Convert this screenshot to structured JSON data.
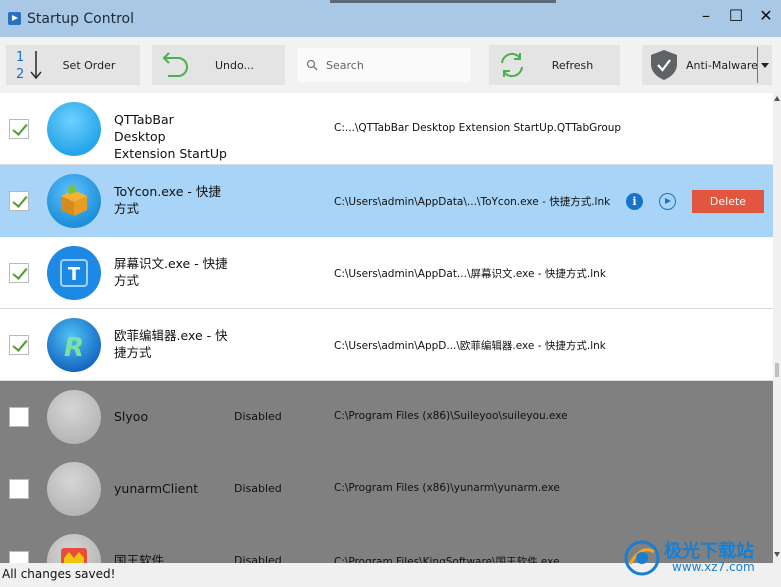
{
  "window": {
    "title": "Startup Control",
    "minimize_glyph": "–",
    "maximize_glyph": "☐",
    "close_glyph": "✕"
  },
  "toolbar": {
    "set_order_label": "Set Order",
    "set_order_digits": [
      "1",
      "2"
    ],
    "undo_label": "Undo...",
    "search_placeholder": "Search",
    "refresh_label": "Refresh",
    "antimalware_label": "Anti-Malware"
  },
  "rows": [
    {
      "name": "QTTabBar Desktop Extension StartUp",
      "path": "C:...\\QTTabBar Desktop Extension StartUp.QTTabGroup",
      "checked": true,
      "status": "",
      "state": "enabled",
      "icon": "blue-circle-icon"
    },
    {
      "name": "ToYcon.exe - 快捷方式",
      "path": "C:\\Users\\admin\\AppData\\...\\ToYcon.exe - 快捷方式.lnk",
      "checked": true,
      "status": "",
      "state": "selected",
      "icon": "box-icon",
      "delete_label": "Delete",
      "info_label": "i"
    },
    {
      "name": "屏幕识文.exe - 快捷方式",
      "path": "C:\\Users\\admin\\AppDat...\\屏幕识文.exe - 快捷方式.lnk",
      "checked": true,
      "status": "",
      "state": "enabled",
      "icon": "text-t-icon",
      "icon_letter": "T"
    },
    {
      "name": "欧菲编辑器.exe - 快捷方式",
      "path": "C:\\Users\\admin\\AppD...\\欧菲编辑器.exe - 快捷方式.lnk",
      "checked": true,
      "status": "",
      "state": "enabled",
      "icon": "r-logo-icon",
      "icon_letter": "R"
    },
    {
      "name": "Slyoo",
      "path": "C:\\Program Files (x86)\\Suileyoo\\suileyou.exe",
      "checked": false,
      "status": "Disabled",
      "state": "disabled",
      "icon": "grey-circle-icon"
    },
    {
      "name": "yunarmClient",
      "path": "C:\\Program Files (x86)\\yunarm\\yunarm.exe",
      "checked": false,
      "status": "Disabled",
      "state": "disabled",
      "icon": "grey-circle-icon"
    },
    {
      "name": "国王软件",
      "path": "C:\\Program Files\\KingSoftware\\国王软件.exe",
      "checked": false,
      "status": "Disabled",
      "state": "disabled",
      "icon": "king-icon"
    }
  ],
  "statusbar": {
    "message": "All changes saved!"
  },
  "watermark": {
    "text": "极光下载站",
    "url": "www.xz7.com"
  },
  "colors": {
    "titlebar": "#a9c8e6",
    "selected_row": "#a8d4f7",
    "disabled_row": "#808080",
    "delete": "#e2553f",
    "accent": "#1673c9",
    "check": "#4f9a2f"
  }
}
